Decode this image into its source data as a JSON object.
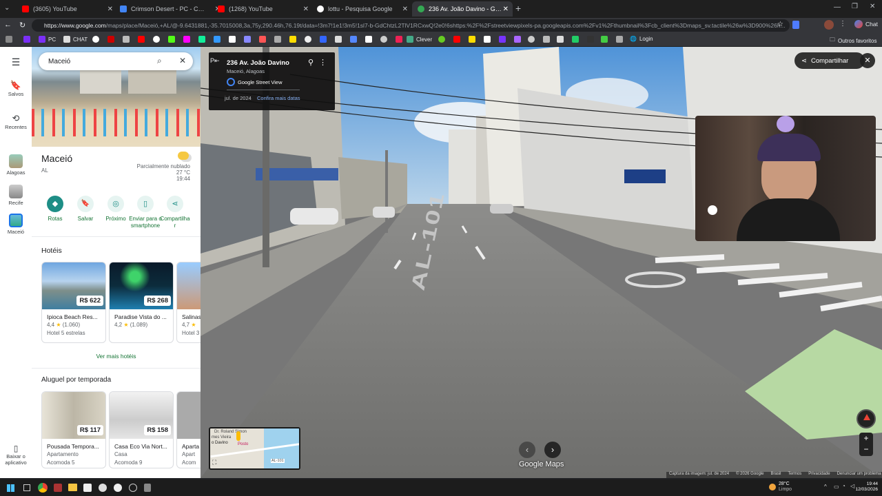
{
  "tabs": [
    {
      "label": "(3605) YouTube",
      "color": "#ff0000"
    },
    {
      "label": "Crimson Desert - PC - Compre na",
      "color": "#4285f4"
    },
    {
      "label": "(1268) YouTube",
      "color": "#ff0000"
    },
    {
      "label": "lottu - Pesquisa Google",
      "color": "#ffffff"
    },
    {
      "label": "236 Av. João Davino - Google Ma",
      "color": "#34a853"
    }
  ],
  "address": {
    "host": "https://www.google.com",
    "path": "/maps/place/Maceió,+AL/@-9.6431881,-35.7015008,3a,75y,290.46h,76.19t/data=!3m7!1e1!3m5!1sl7-b-GdChtzL2TlV1RCxwQ!2e0!6shttps:%2F%2Fstreetviewpixels-pa.googleapis.com%2Fv1%2Fthumbnail%3Fcb_client%3Dmaps_sv.tactile%26w%3D900%26h..."
  },
  "bookmarks": [
    "PC",
    "CHAT",
    "Clever",
    "Login",
    "Outros favoritos"
  ],
  "browser_right": {
    "chat_label": "Chat"
  },
  "search": {
    "value": "Maceió"
  },
  "rail": {
    "saved": "Salvos",
    "recent": "Recentes",
    "alagoas": "Alagoas",
    "recife": "Recife",
    "maceio": "Maceió",
    "download": "Baixar o aplicativo"
  },
  "place": {
    "name": "Maceió",
    "region": "AL",
    "weather_desc": "Parcialmente nublado",
    "temp": "27 °C",
    "time": "19:44"
  },
  "actions": [
    "Rotas",
    "Salvar",
    "Próximo",
    "Enviar para o smartphone",
    "Compartilhar"
  ],
  "hotels": {
    "heading": "Hotéis",
    "items": [
      {
        "name": "Ipioca Beach Res...",
        "rating": "4,4",
        "reviews": "(1.060)",
        "type": "Hotel 5 estrelas",
        "price": "R$ 622"
      },
      {
        "name": "Paradise Vista do ...",
        "rating": "4,2",
        "reviews": "(1.089)",
        "type": "",
        "price": "R$ 268"
      },
      {
        "name": "Salinas",
        "rating": "4,7",
        "reviews": "",
        "type": "Hotel 3",
        "price": ""
      }
    ],
    "more": "Ver mais hotéis"
  },
  "rentals": {
    "heading": "Aluguel por temporada",
    "items": [
      {
        "name": "Pousada Tempora...",
        "type": "Apartamento",
        "guests": "Acomoda 5",
        "price": "R$ 117"
      },
      {
        "name": "Casa Eco Via Nort...",
        "type": "Casa",
        "guests": "Acomoda 9",
        "price": "R$ 158"
      },
      {
        "name": "Aparta",
        "type": "Apart",
        "guests": "Acom",
        "price": ""
      }
    ]
  },
  "streetview": {
    "address": "236 Av. João Davino",
    "city": "Maceió, Alagoas",
    "brand": "Google Street View",
    "date": "jul. de 2024",
    "more_dates": "Confira mais datas",
    "share": "Compartilhar",
    "road_text": "AL-101",
    "logo": "Google Maps",
    "footer": [
      "Captura da imagem: jul. de 2024",
      "© 2026 Google",
      "Brasil",
      "Termos",
      "Privacidade",
      "Denunciar um problema"
    ],
    "minimap_labels": [
      "Dr. Roland Simon",
      "mes Vieira",
      "o Davino",
      "Posto",
      "AL-101"
    ]
  },
  "taskbar": {
    "temp": "28°C",
    "cond": "Limpo",
    "time": "19:44",
    "date": "12/03/2026"
  },
  "colors": {
    "accent": "#1a73e8",
    "teal": "#1e8e86",
    "maps_red": "#ea4335"
  }
}
